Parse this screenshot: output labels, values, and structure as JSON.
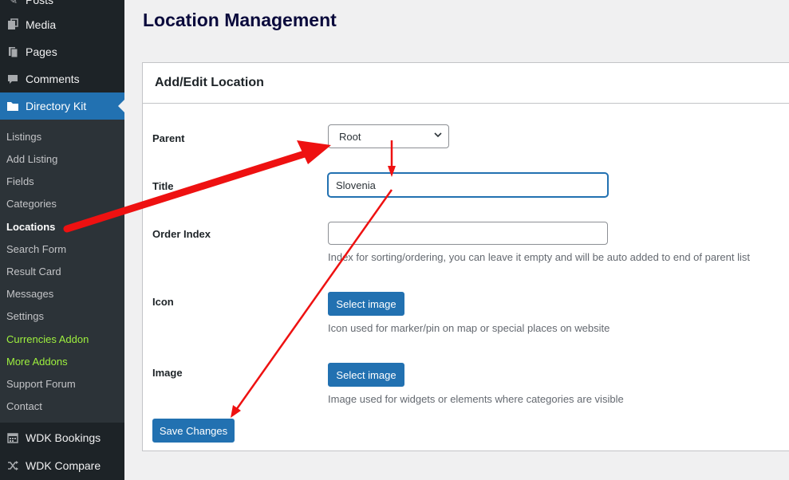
{
  "sidebar": {
    "top_items": [
      {
        "label": "Posts",
        "icon": "pin-icon"
      },
      {
        "label": "Media",
        "icon": "media-icon"
      },
      {
        "label": "Pages",
        "icon": "pages-icon"
      },
      {
        "label": "Comments",
        "icon": "comment-icon"
      }
    ],
    "active_item": {
      "label": "Directory Kit",
      "icon": "folder-icon"
    },
    "submenu": [
      {
        "label": "Listings"
      },
      {
        "label": "Add Listing"
      },
      {
        "label": "Fields"
      },
      {
        "label": "Categories"
      },
      {
        "label": "Locations"
      },
      {
        "label": "Search Form"
      },
      {
        "label": "Result Card"
      },
      {
        "label": "Messages"
      },
      {
        "label": "Settings"
      },
      {
        "label": "Currencies Addon"
      },
      {
        "label": "More Addons"
      },
      {
        "label": "Support Forum"
      },
      {
        "label": "Contact"
      }
    ],
    "bottom_items": [
      {
        "label": "WDK Bookings",
        "icon": "calendar-icon"
      },
      {
        "label": "WDK Compare",
        "icon": "shuffle-icon"
      }
    ]
  },
  "page": {
    "title": "Location Management"
  },
  "form": {
    "heading": "Add/Edit Location",
    "parent": {
      "label": "Parent",
      "selected": "Root"
    },
    "title": {
      "label": "Title",
      "value": "Slovenia"
    },
    "order_index": {
      "label": "Order Index",
      "value": "",
      "help": "Index for sorting/ordering, you can leave it empty and will be auto added to end of parent list"
    },
    "icon": {
      "label": "Icon",
      "button": "Select image",
      "help": "Icon used for marker/pin on map or special places on website"
    },
    "image": {
      "label": "Image",
      "button": "Select image",
      "help": "Image used for widgets or elements where categories are visible"
    },
    "save_button": "Save Changes"
  },
  "colors": {
    "sidebar_bg": "#1d2327",
    "submenu_bg": "#2c3338",
    "accent": "#2271b1",
    "addon_text": "#9ef03e",
    "annotation_arrow": "#ee1111"
  }
}
